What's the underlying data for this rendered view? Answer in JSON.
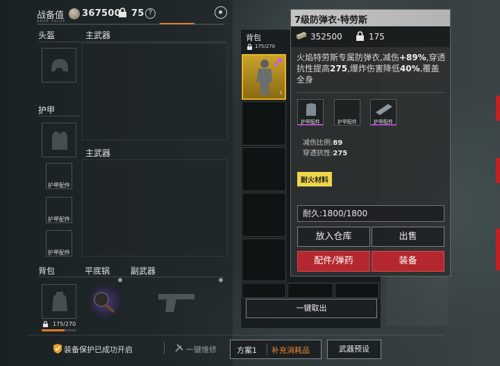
{
  "topbar": {
    "gear_value_label": "战备值",
    "gear_value": "367500",
    "armor_lock_value": "75",
    "help_glyph": "?"
  },
  "loadout": {
    "helmet_label": "头盔",
    "primary_weapon_label": "主武器",
    "armor_label": "护甲",
    "primary_weapon2_label": "主武器",
    "armor_attachment_label": "护甲配件",
    "backpack_label": "背包",
    "pan_label": "平底锅",
    "secondary_weapon_label": "副武器",
    "backpack_capacity": "175/270",
    "backpack_fill_percent": 65
  },
  "backpack_panel": {
    "title": "背包",
    "capacity": "175/270",
    "selected_item_count": "1",
    "one_click_remove": "一键取出"
  },
  "detail": {
    "title": "7级防弹衣·特劳斯",
    "value": "352500",
    "lock_value": "175",
    "desc_pre": "火焰特劳斯专属防弹衣,减伤",
    "desc_hl1": "+89%",
    "desc_mid1": ",穿透抗性提高",
    "desc_hl2": "275",
    "desc_mid2": ",爆炸伤害降低",
    "desc_hl3": "40%",
    "desc_post": ",覆盖全身",
    "attachments": [
      "护甲配件",
      "护甲配件",
      "护甲配件"
    ],
    "stat_reduction_label": "减伤比例:",
    "stat_reduction_value": "89",
    "stat_pen_label": "穿透抗性:",
    "stat_pen_value": "275",
    "tag": "耐火材料",
    "durability": "耐久:1800/1800",
    "btn_store": "放入仓库",
    "btn_sell": "出售",
    "btn_attach": "配件/弹药",
    "btn_equip": "装备"
  },
  "bottom": {
    "protect_msg": "装备保护已成功开启",
    "repair": "一键维修",
    "plan": "方案1",
    "restock": "补充消耗品",
    "weapon_preset": "武器预设"
  },
  "colors": {
    "accent_orange": "#f08a2c",
    "red_button": "#b5272e",
    "selected_gold": "#e8b52a",
    "tag_yellow": "#efd64a"
  }
}
